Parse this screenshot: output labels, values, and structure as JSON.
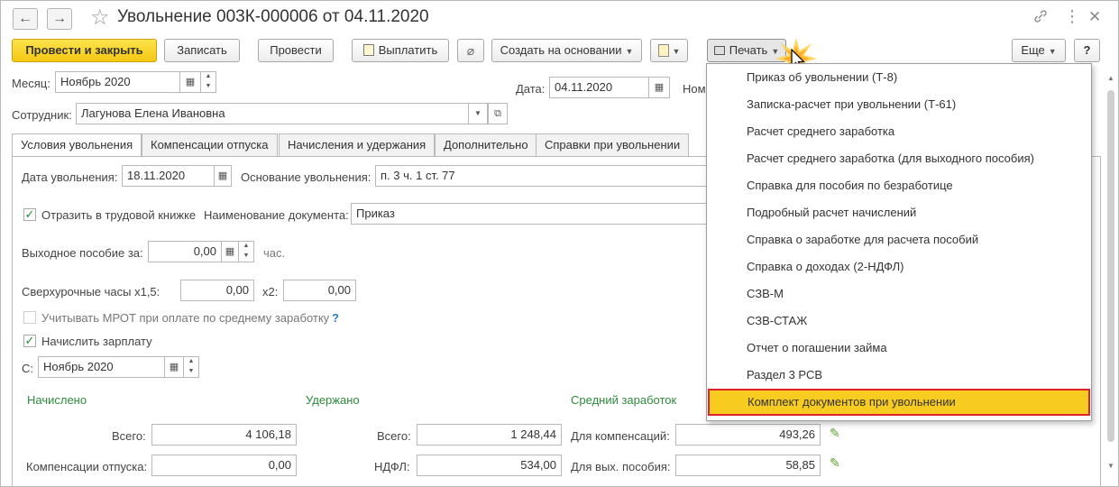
{
  "window": {
    "title": "Увольнение 003К-000006 от 04.11.2020",
    "back_glyph": "←",
    "forward_glyph": "→",
    "icons": [
      "star-icon",
      "link-icon",
      "more-icon",
      "close-icon"
    ]
  },
  "toolbar": {
    "post_close": "Провести и закрыть",
    "save": "Записать",
    "post": "Провести",
    "pay": "Выплатить",
    "create_based": "Создать на основании",
    "print": "Печать",
    "more": "Еще",
    "help": "?"
  },
  "header": {
    "month_label": "Месяц:",
    "month_value": "Ноябрь 2020",
    "date_label": "Дата:",
    "date_value": "04.11.2020",
    "number_label_partial": "Ном",
    "employee_label": "Сотрудник:",
    "employee_value": "Лагунова Елена Ивановна"
  },
  "tabs": [
    {
      "label": "Условия увольнения",
      "active": true
    },
    {
      "label": "Компенсации отпуска",
      "active": false
    },
    {
      "label": "Начисления и удержания",
      "active": false
    },
    {
      "label": "Дополнительно",
      "active": false
    },
    {
      "label": "Справки при увольнении",
      "active": false
    }
  ],
  "conditions": {
    "dismissal_date_label": "Дата увольнения:",
    "dismissal_date_value": "18.11.2020",
    "basis_label": "Основание увольнения:",
    "basis_value": "п. 3 ч. 1 ст. 77",
    "workbook_label": "Отразить в трудовой книжке",
    "workbook_checked": true,
    "doc_name_label": "Наименование документа:",
    "doc_name_value": "Приказ",
    "severance_label": "Выходное пособие за:",
    "severance_value": "0,00",
    "severance_unit": "час.",
    "overtime_label": "Сверхурочные часы x1,5:",
    "overtime_x15_value": "0,00",
    "x2_label": "x2:",
    "overtime_x2_value": "0,00",
    "mrot_label": "Учитывать МРОТ при оплате по среднему заработку",
    "mrot_checked": false,
    "mrot_help": "?",
    "accrue_label": "Начислить зарплату",
    "accrue_checked": true,
    "from_label": "С:",
    "from_value": "Ноябрь 2020"
  },
  "totals": {
    "accrued_header": "Начислено",
    "withheld_header": "Удержано",
    "avg_header": "Средний заработок",
    "total_label": "Всего:",
    "accrued_total": "4 106,18",
    "withheld_total_label": "Всего:",
    "withheld_total": "1 248,44",
    "comp_label": "Для компенсаций:",
    "comp_value": "493,26",
    "vacation_comp_label": "Компенсации отпуска:",
    "vacation_comp_value": "0,00",
    "ndfl_label": "НДФЛ:",
    "ndfl_value": "534,00",
    "severance_avg_label": "Для вых. пособия:",
    "severance_avg_value": "58,85"
  },
  "print_menu": {
    "items": [
      "Приказ об увольнении (Т-8)",
      "Записка-расчет при увольнении (Т-61)",
      "Расчет среднего заработка",
      "Расчет среднего заработка (для выходного пособия)",
      "Справка для пособия по безработице",
      "Подробный расчет начислений",
      "Справка о заработке для расчета пособий",
      "Справка о доходах (2-НДФЛ)",
      "СЗВ-М",
      "СЗВ-СТАЖ",
      "Отчет о погашении займа",
      "Раздел 3 РСВ",
      "Комплект документов при увольнении"
    ],
    "highlighted_index": 12
  },
  "colors": {
    "primary_button": "#f5c813",
    "highlight": "#f7cb20",
    "highlight_border": "#e0222b",
    "green_headers": "#2e8b3c"
  }
}
